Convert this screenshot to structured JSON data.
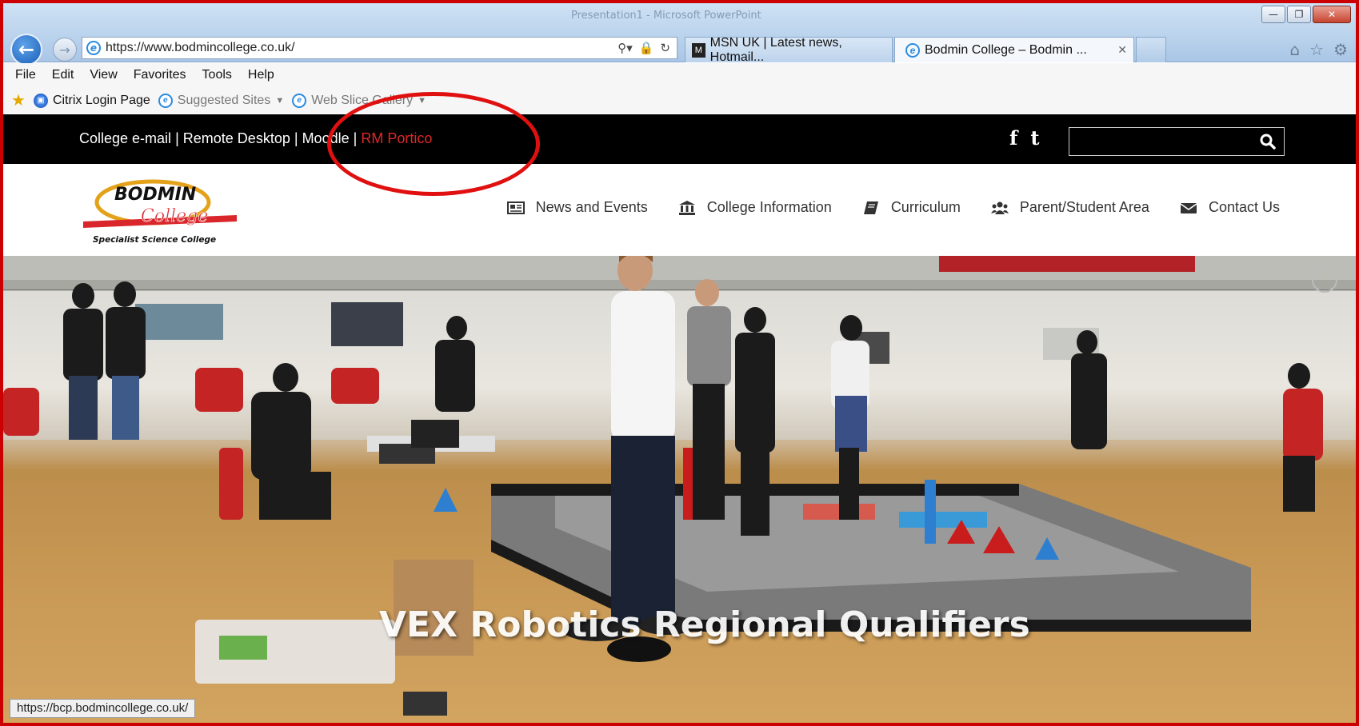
{
  "browser": {
    "window_title": "Presentation1 - Microsoft PowerPoint",
    "url": "https://www.bodmincollege.co.uk/",
    "tabs": [
      {
        "label": "MSN UK | Latest news, Hotmail...",
        "active": false
      },
      {
        "label": "Bodmin College – Bodmin ...",
        "active": true
      }
    ],
    "menu": [
      "File",
      "Edit",
      "View",
      "Favorites",
      "Tools",
      "Help"
    ],
    "favorites": [
      {
        "label": "Citrix Login Page"
      },
      {
        "label": "Suggested Sites"
      },
      {
        "label": "Web Slice Gallery"
      }
    ],
    "status_url": "https://bcp.bodmincollege.co.uk/"
  },
  "site": {
    "toplinks": {
      "email": "College e-mail",
      "sep": "|",
      "remote": "Remote Desktop",
      "moodle": "Moodle",
      "portico": "RM Portico"
    },
    "social": {
      "facebook": "f",
      "twitter": "t"
    },
    "search": {
      "placeholder": ""
    },
    "logo": {
      "line1": "BODMIN",
      "line2": "College",
      "tagline": "Specialist Science College"
    },
    "nav": [
      {
        "label": "News and Events",
        "icon": "newspaper-icon"
      },
      {
        "label": "College Information",
        "icon": "institution-icon"
      },
      {
        "label": "Curriculum",
        "icon": "book-icon"
      },
      {
        "label": "Parent/Student Area",
        "icon": "users-icon"
      },
      {
        "label": "Contact Us",
        "icon": "envelope-icon"
      }
    ],
    "hero_caption": "VEX Robotics Regional Qualifiers"
  },
  "colors": {
    "accent_red": "#e0282a",
    "annotation_red": "#e01010",
    "topbar": "#000000"
  }
}
